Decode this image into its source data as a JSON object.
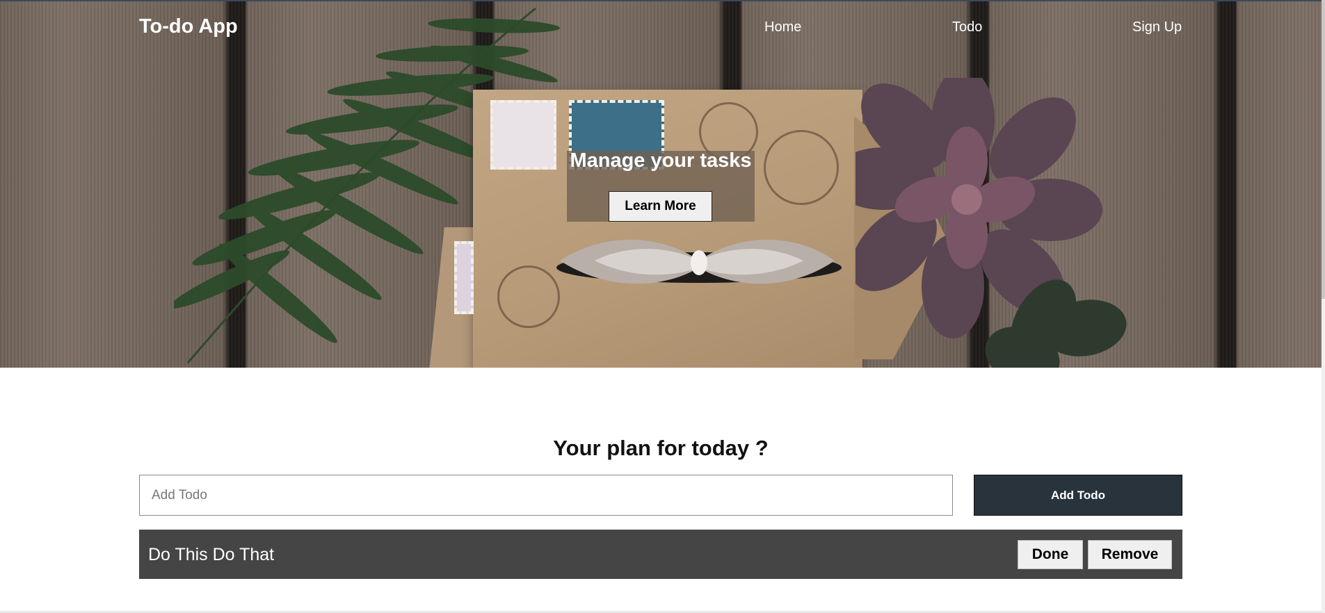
{
  "header": {
    "brand": "To-do App",
    "nav": [
      {
        "label": "Home"
      },
      {
        "label": "Todo"
      },
      {
        "label": "Sign Up"
      }
    ]
  },
  "hero": {
    "title": "Manage your tasks",
    "button_label": "Learn More"
  },
  "main": {
    "heading": "Your plan for today ?",
    "input_placeholder": "Add Todo",
    "input_value": "",
    "add_button_label": "Add Todo",
    "todos": [
      {
        "text": "Do This Do That",
        "done_label": "Done",
        "remove_label": "Remove"
      }
    ]
  },
  "colors": {
    "add_button_bg": "#29333c",
    "todo_row_bg": "#454545"
  }
}
